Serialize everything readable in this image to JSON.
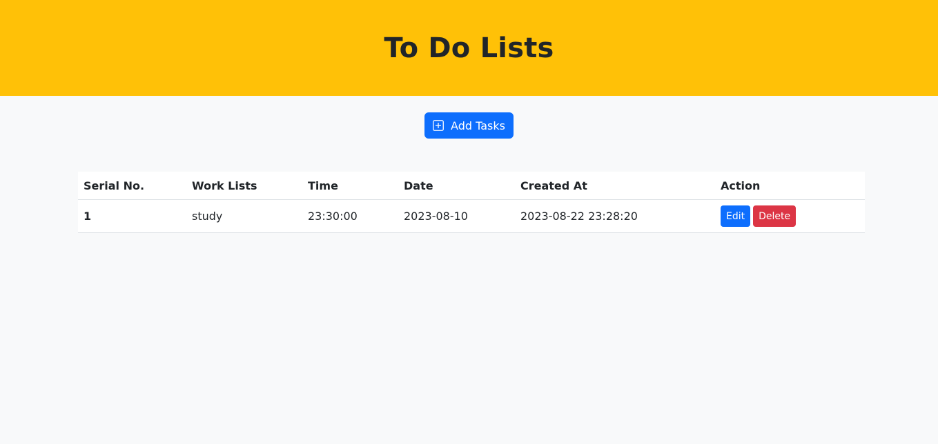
{
  "header": {
    "title": "To Do Lists"
  },
  "toolbar": {
    "add_label": "Add Tasks",
    "add_icon": "plus-square-icon"
  },
  "table": {
    "columns": [
      "Serial No.",
      "Work Lists",
      "Time",
      "Date",
      "Created At",
      "Action"
    ],
    "rows": [
      {
        "serial": "1",
        "work": "study",
        "time": "23:30:00",
        "date": "2023-08-10",
        "created_at": "2023-08-22 23:28:20",
        "edit_label": "Edit",
        "delete_label": "Delete"
      }
    ]
  },
  "colors": {
    "header_bg": "#ffc107",
    "primary": "#0d6efd",
    "danger": "#dc3545",
    "page_bg": "#f8f9fa"
  }
}
